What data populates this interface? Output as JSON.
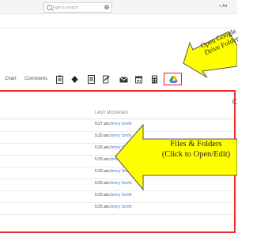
{
  "search": {
    "placeholder": "Type to search",
    "clear_icon": "clear-icon"
  },
  "header": {
    "add_label": "+ Ad"
  },
  "tabs": {
    "chart_label": "Chart",
    "comments_label": "Comments"
  },
  "toolbar_icons": [
    "clipboard-icon",
    "diamond-icon",
    "document-icon",
    "signature-icon",
    "mail-icon",
    "calendar-icon",
    "calculator-icon",
    "google-drive-icon"
  ],
  "table": {
    "column_last_modified": "LAST MODIFIED"
  },
  "rows": [
    {
      "time": "5:27 am",
      "user": "Jimmy Smith"
    },
    {
      "time": "5:20 am",
      "user": "Jimmy Smith"
    },
    {
      "time": "5:26 am",
      "user": "Jimmy Smith"
    },
    {
      "time": "5:25 am",
      "user": "Jimmy Smith"
    },
    {
      "time": "5:20 am",
      "user": "Jimmy Smith"
    },
    {
      "time": "5:26 am",
      "user": "Jimmy Smith"
    },
    {
      "time": "5:25 am",
      "user": "Jimmy Smith"
    },
    {
      "time": "5:25 am",
      "user": "Jimmy Smith"
    }
  ],
  "annotations": {
    "drive_line1": "Open Google",
    "drive_line2": "Drive Folder",
    "files_line1": "Files & Folders",
    "files_line2": "(Click to Open/Edit)"
  },
  "colors": {
    "highlight_red": "#e82a2a",
    "callout_yellow": "#ffff00",
    "link_blue": "#4a7bd0"
  }
}
